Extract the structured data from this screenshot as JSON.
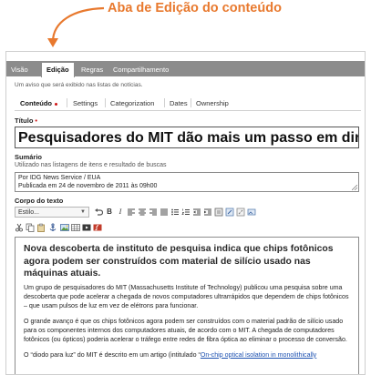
{
  "annotation": {
    "label": "Aba de Edição do conteúdo"
  },
  "top_tabs": [
    {
      "label": "Visão",
      "active": false
    },
    {
      "label": "Edição",
      "active": true
    },
    {
      "label": "Regras",
      "active": false
    },
    {
      "label": "Compartilhamento",
      "active": false
    }
  ],
  "notice": "Um aviso que será exibido nas listas de notícias.",
  "sub_tabs": [
    {
      "label": "Conteúdo",
      "active": true
    },
    {
      "label": "Settings",
      "active": false
    },
    {
      "label": "Categorization",
      "active": false
    },
    {
      "label": "Dates",
      "active": false
    },
    {
      "label": "Ownership",
      "active": false
    }
  ],
  "title_field": {
    "label": "Título",
    "value": "Pesquisadores do MIT dão mais um passo em direção a"
  },
  "summary_field": {
    "label": "Sumário",
    "help": "Utilizado nas listagens de itens e resultado de buscas",
    "lines": [
      "Por IDG News Service / EUA",
      "Publicada em 24 de novembro de 2011 às 09h00"
    ]
  },
  "body_field": {
    "label": "Corpo do texto"
  },
  "toolbar": {
    "style_select": "Estilo..."
  },
  "editor": {
    "heading": "Nova descoberta de instituto de pesquisa indica que chips fotônicos agora podem ser construídos com material de silício usado nas máquinas atuais.",
    "p1": "Um grupo de pesquisadores do MIT (Massachusetts Institute of Technology) publicou uma pesquisa sobre uma descoberta que pode acelerar a chegada de novos computadores ultrarrápidos que dependem de chips fotônicos – que usam pulsos de luz em vez de elétrons para funcionar.",
    "p2": "O grande avanço é que os chips fotônicos agora podem ser construídos com o material padrão de silício usado para os componentes internos dos computadores atuais, de acordo com o MIT. A chegada de computadores fotônicos (ou ópticos) poderia acelerar o tráfego entre redes de fibra óptica ao eliminar o processo de conversão.",
    "p3_start": "O “diodo para luz” do MIT é descrito em um artigo (intitulado “",
    "p3_link": "On-chip optical isolation in monolithically"
  },
  "colors": {
    "accent": "#e8792e",
    "required": "#d01616",
    "tabbar": "#8c8c8c",
    "link": "#1a4fb0"
  }
}
